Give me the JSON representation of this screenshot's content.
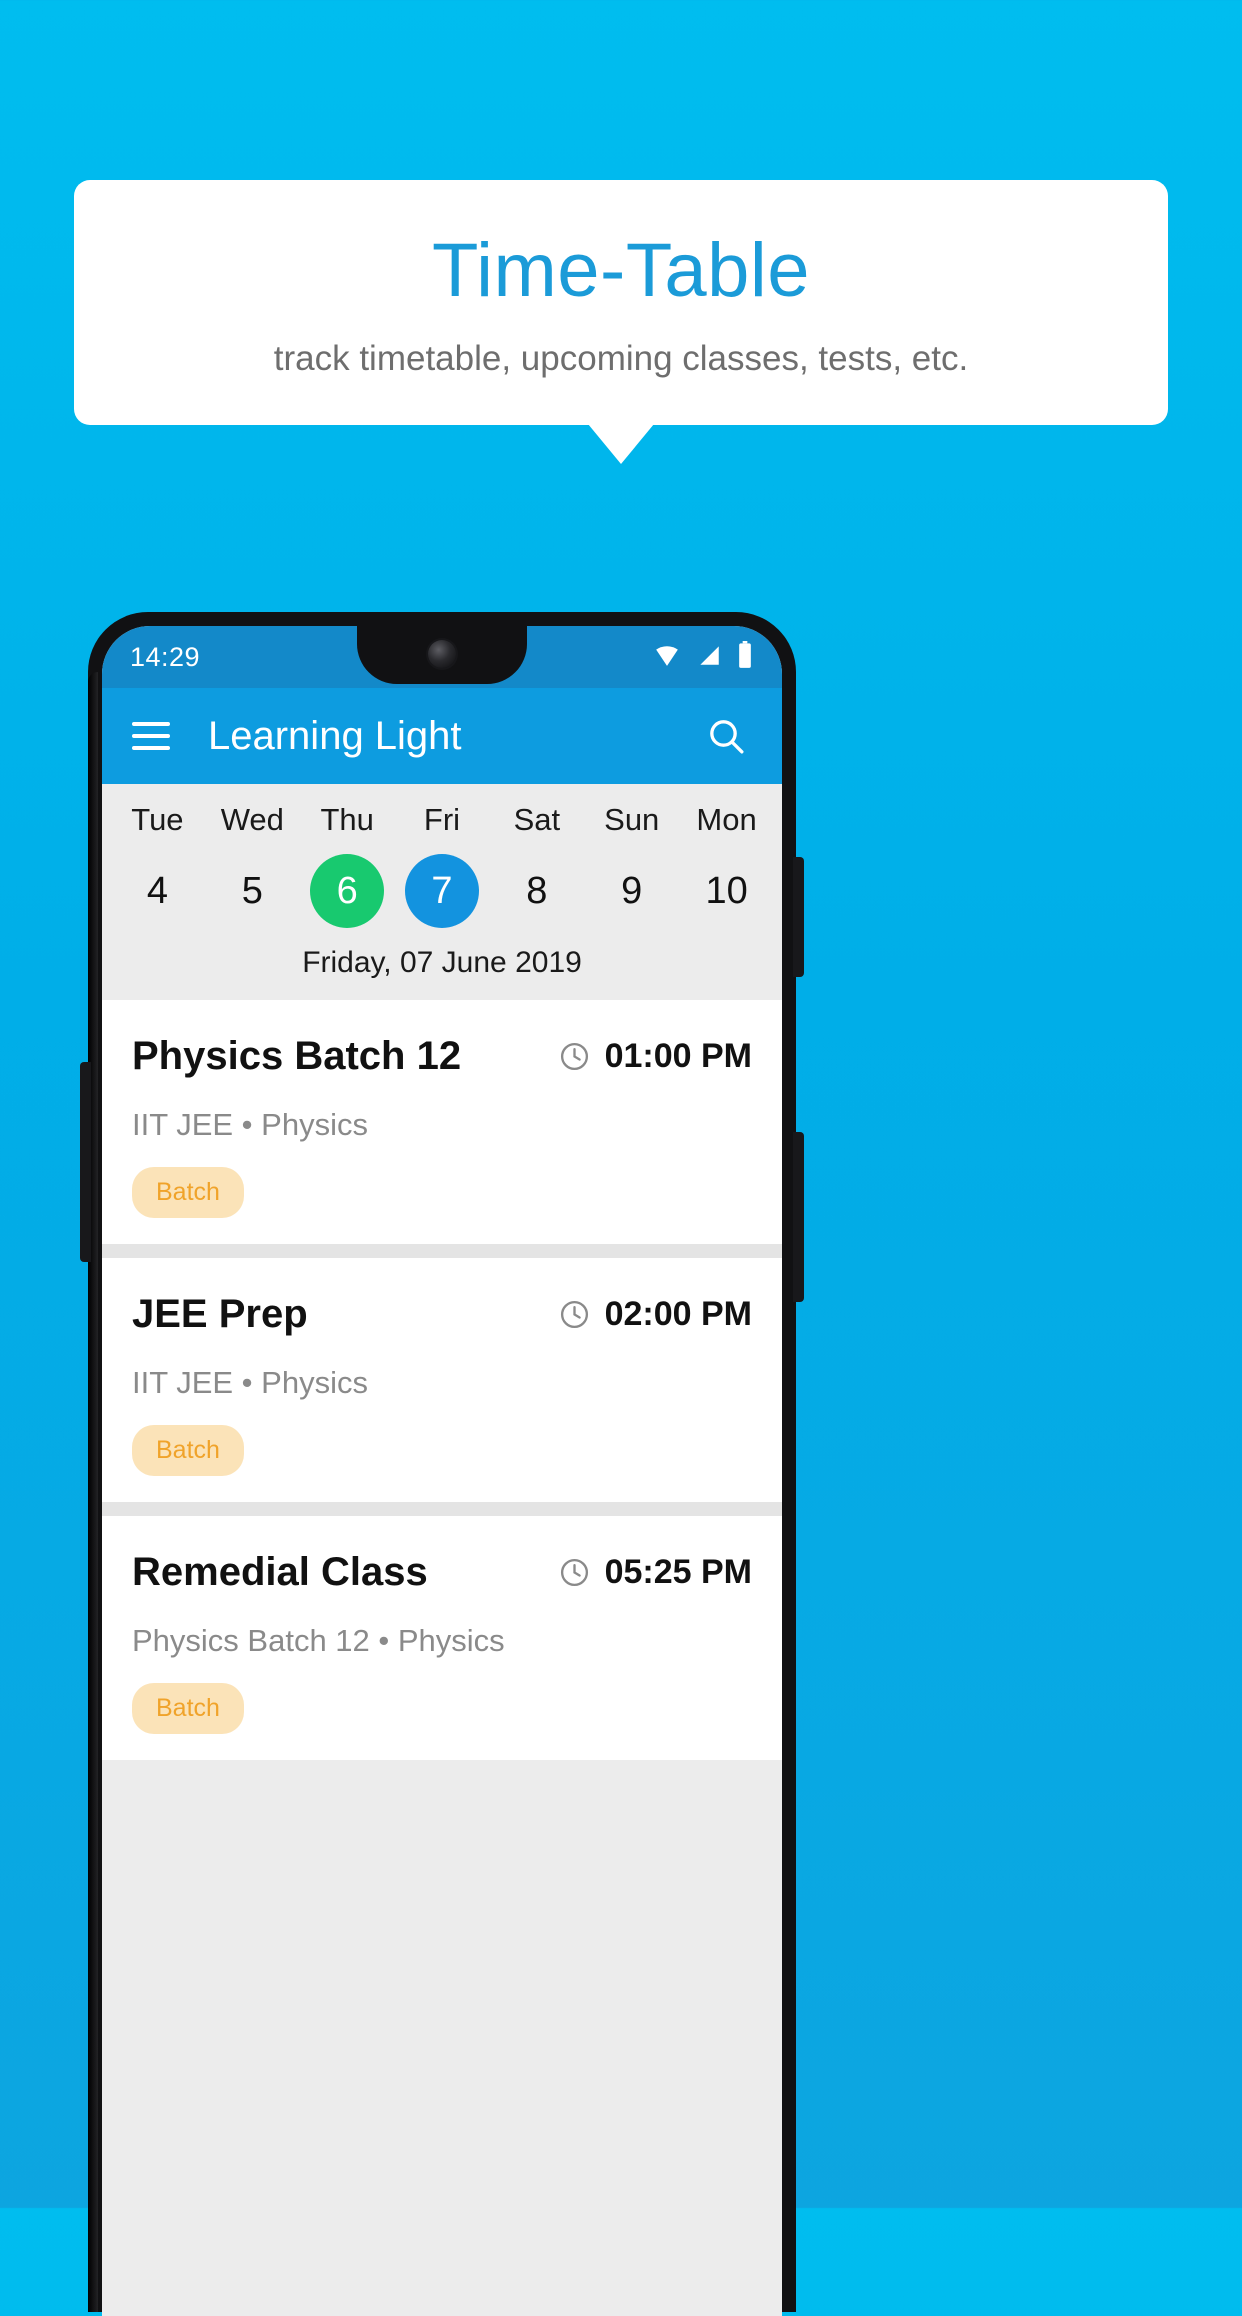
{
  "promo": {
    "title": "Time-Table",
    "subtitle": "track timetable, upcoming classes, tests, etc.",
    "title_color": "#1B9BD8",
    "background_color": "#00AEE8"
  },
  "phone": {
    "status_bar": {
      "time": "14:29",
      "icons": [
        "wifi-icon",
        "signal-icon",
        "battery-icon"
      ]
    },
    "app_bar": {
      "menu_icon": "hamburger-menu-icon",
      "title": "Learning Light",
      "search_icon": "search-icon"
    },
    "date_strip": {
      "days": [
        {
          "name": "Tue",
          "num": "4",
          "state": "normal"
        },
        {
          "name": "Wed",
          "num": "5",
          "state": "normal"
        },
        {
          "name": "Thu",
          "num": "6",
          "state": "today"
        },
        {
          "name": "Fri",
          "num": "7",
          "state": "selected"
        },
        {
          "name": "Sat",
          "num": "8",
          "state": "normal"
        },
        {
          "name": "Sun",
          "num": "9",
          "state": "normal"
        },
        {
          "name": "Mon",
          "num": "10",
          "state": "normal"
        }
      ],
      "today_color": "#18C96F",
      "selected_color": "#1393DF",
      "full_date": "Friday, 07 June 2019"
    },
    "events": [
      {
        "title": "Physics Batch 12",
        "subtitle": "IIT JEE • Physics",
        "time": "01:00 PM",
        "chip": "Batch",
        "clock_icon": "clock-icon"
      },
      {
        "title": "JEE Prep",
        "subtitle": "IIT JEE • Physics",
        "time": "02:00 PM",
        "chip": "Batch",
        "clock_icon": "clock-icon"
      },
      {
        "title": "Remedial Class",
        "subtitle": "Physics Batch 12 • Physics",
        "time": "05:25 PM",
        "chip": "Batch",
        "clock_icon": "clock-icon"
      }
    ],
    "chip_bg_color": "#FBE3B8",
    "chip_text_color": "#F0A32A",
    "app_bar_color": "#0D9CE0"
  }
}
